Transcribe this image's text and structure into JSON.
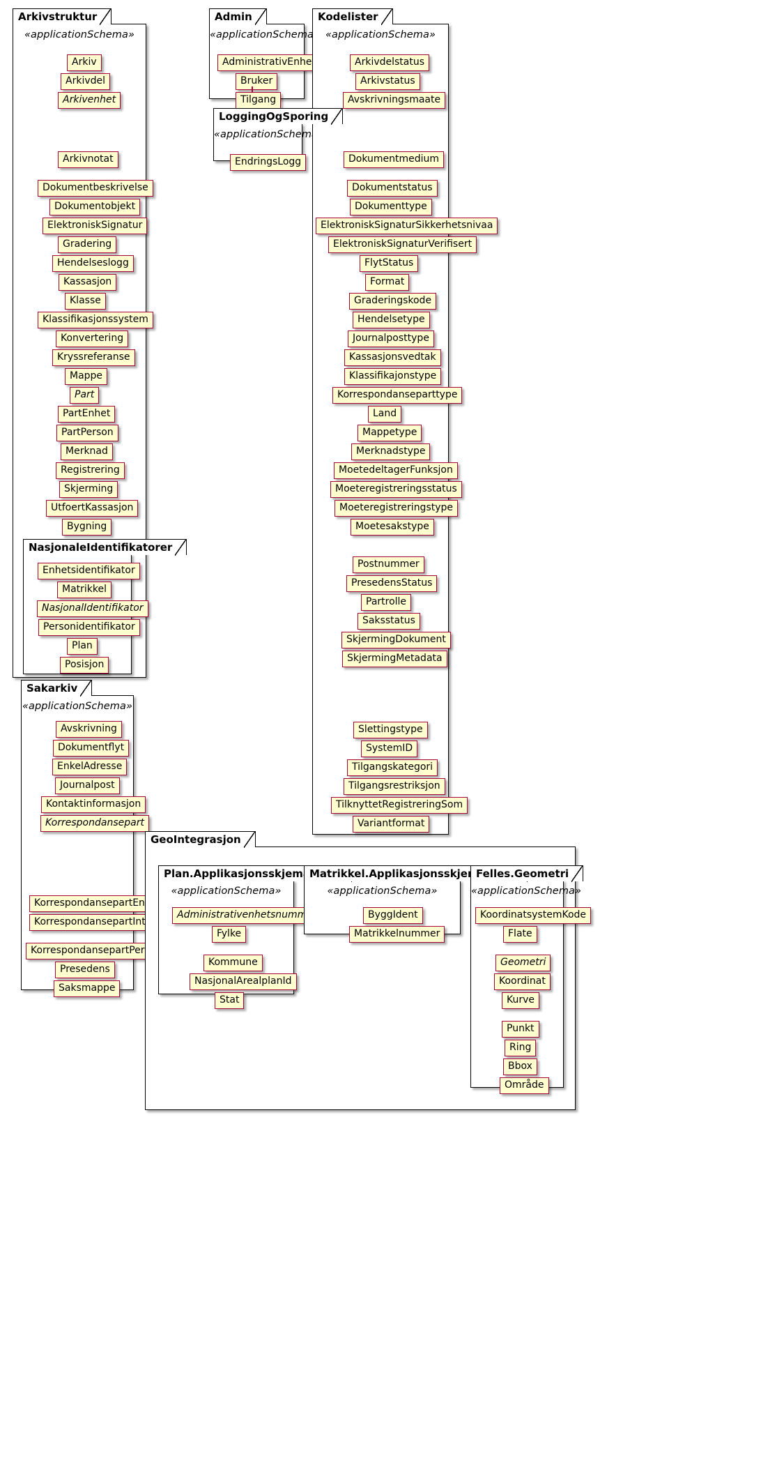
{
  "diagram": {
    "type": "uml-package-diagram",
    "stereotype_label": "«applicationSchema»",
    "colors": {
      "class_fill": "#FEFECE",
      "class_border": "#A80036",
      "package_border": "#000000",
      "background": "#FFFFFF"
    }
  },
  "packages": {
    "arkivstruktur": {
      "name": "Arkivstruktur",
      "stereotype": "«applicationSchema»",
      "classes": [
        {
          "name": "Arkiv",
          "abstract": false
        },
        {
          "name": "Arkivdel",
          "abstract": false
        },
        {
          "name": "Arkivenhet",
          "abstract": true
        },
        {
          "name": "Arkivnotat",
          "abstract": false
        },
        {
          "name": "Dokumentbeskrivelse",
          "abstract": false
        },
        {
          "name": "Dokumentobjekt",
          "abstract": false
        },
        {
          "name": "ElektroniskSignatur",
          "abstract": false
        },
        {
          "name": "Gradering",
          "abstract": false
        },
        {
          "name": "Hendelseslogg",
          "abstract": false
        },
        {
          "name": "Kassasjon",
          "abstract": false
        },
        {
          "name": "Klasse",
          "abstract": false
        },
        {
          "name": "Klassifikasjonssystem",
          "abstract": false
        },
        {
          "name": "Konvertering",
          "abstract": false
        },
        {
          "name": "Kryssreferanse",
          "abstract": false
        },
        {
          "name": "Mappe",
          "abstract": false
        },
        {
          "name": "Part",
          "abstract": true
        },
        {
          "name": "PartEnhet",
          "abstract": false
        },
        {
          "name": "PartPerson",
          "abstract": false
        },
        {
          "name": "Merknad",
          "abstract": false
        },
        {
          "name": "Registrering",
          "abstract": false
        },
        {
          "name": "Skjerming",
          "abstract": false
        },
        {
          "name": "UtfoertKassasjon",
          "abstract": false
        },
        {
          "name": "Bygning",
          "abstract": false
        }
      ],
      "nested": {
        "nasjonaleidentifikatorer": {
          "name": "NasjonaleIdentifikatorer",
          "classes": [
            {
              "name": "Enhetsidentifikator",
              "abstract": false
            },
            {
              "name": "Matrikkel",
              "abstract": false
            },
            {
              "name": "NasjonalIdentifikator",
              "abstract": true
            },
            {
              "name": "Personidentifikator",
              "abstract": false
            },
            {
              "name": "Plan",
              "abstract": false
            },
            {
              "name": "Posisjon",
              "abstract": false
            }
          ]
        }
      }
    },
    "sakarkiv": {
      "name": "Sakarkiv",
      "stereotype": "«applicationSchema»",
      "classes": [
        {
          "name": "Avskrivning",
          "abstract": false
        },
        {
          "name": "Dokumentflyt",
          "abstract": false
        },
        {
          "name": "EnkelAdresse",
          "abstract": false
        },
        {
          "name": "Journalpost",
          "abstract": false
        },
        {
          "name": "Kontaktinformasjon",
          "abstract": false
        },
        {
          "name": "Korrespondansepart",
          "abstract": true
        },
        {
          "name": "KorrespondansepartEnhet",
          "abstract": false
        },
        {
          "name": "KorrespondansepartIntern",
          "abstract": false
        },
        {
          "name": "KorrespondansepartPerson",
          "abstract": false
        },
        {
          "name": "Presedens",
          "abstract": false
        },
        {
          "name": "Saksmappe",
          "abstract": false
        }
      ]
    },
    "admin": {
      "name": "Admin",
      "stereotype": "«applicationSchema»",
      "classes": [
        {
          "name": "AdministrativEnhet",
          "abstract": false
        },
        {
          "name": "Bruker",
          "abstract": false
        },
        {
          "name": "Tilgang",
          "abstract": false
        }
      ]
    },
    "loggingogsporing": {
      "name": "LoggingOgSporing",
      "stereotype": "«applicationSchema»",
      "classes": [
        {
          "name": "EndringsLogg",
          "abstract": false
        }
      ]
    },
    "kodelister": {
      "name": "Kodelister",
      "stereotype": "«applicationSchema»",
      "classes": [
        {
          "name": "Arkivdelstatus",
          "abstract": false
        },
        {
          "name": "Arkivstatus",
          "abstract": false
        },
        {
          "name": "Avskrivningsmaate",
          "abstract": false
        },
        {
          "name": "Dokumentmedium",
          "abstract": false
        },
        {
          "name": "Dokumentstatus",
          "abstract": false
        },
        {
          "name": "Dokumenttype",
          "abstract": false
        },
        {
          "name": "ElektroniskSignaturSikkerhetsnivaa",
          "abstract": false
        },
        {
          "name": "ElektroniskSignaturVerifisert",
          "abstract": false
        },
        {
          "name": "FlytStatus",
          "abstract": false
        },
        {
          "name": "Format",
          "abstract": false
        },
        {
          "name": "Graderingskode",
          "abstract": false
        },
        {
          "name": "Hendelsetype",
          "abstract": false
        },
        {
          "name": "Journalposttype",
          "abstract": false
        },
        {
          "name": "Kassasjonsvedtak",
          "abstract": false
        },
        {
          "name": "Klassifikajonstype",
          "abstract": false
        },
        {
          "name": "Korrespondanseparttype",
          "abstract": false
        },
        {
          "name": "Land",
          "abstract": false
        },
        {
          "name": "Mappetype",
          "abstract": false
        },
        {
          "name": "Merknadstype",
          "abstract": false
        },
        {
          "name": "MoetedeltagerFunksjon",
          "abstract": false
        },
        {
          "name": "Moeteregistreringsstatus",
          "abstract": false
        },
        {
          "name": "Moeteregistreringstype",
          "abstract": false
        },
        {
          "name": "Moetesakstype",
          "abstract": false
        },
        {
          "name": "Postnummer",
          "abstract": false
        },
        {
          "name": "PresedensStatus",
          "abstract": false
        },
        {
          "name": "Partrolle",
          "abstract": false
        },
        {
          "name": "Saksstatus",
          "abstract": false
        },
        {
          "name": "SkjermingDokument",
          "abstract": false
        },
        {
          "name": "SkjermingMetadata",
          "abstract": false
        },
        {
          "name": "Slettingstype",
          "abstract": false
        },
        {
          "name": "SystemID",
          "abstract": false
        },
        {
          "name": "Tilgangskategori",
          "abstract": false
        },
        {
          "name": "Tilgangsrestriksjon",
          "abstract": false
        },
        {
          "name": "TilknyttetRegistreringSom",
          "abstract": false
        },
        {
          "name": "Variantformat",
          "abstract": false
        }
      ]
    },
    "geointegrasjon": {
      "name": "GeoIntegrasjon",
      "nested": {
        "plan_felles": {
          "name": "Plan.Applikasjonsskjema.Felles",
          "stereotype": "«applicationSchema»",
          "classes": [
            {
              "name": "Administrativenhetsnummer",
              "abstract": true
            },
            {
              "name": "Fylke",
              "abstract": false
            },
            {
              "name": "Kommune",
              "abstract": false
            },
            {
              "name": "NasjonalArealplanId",
              "abstract": false
            },
            {
              "name": "Stat",
              "abstract": false
            }
          ]
        },
        "matrikkel_felles": {
          "name": "Matrikkel.Applikasjonsskjema.Felles",
          "stereotype": "«applicationSchema»",
          "classes": [
            {
              "name": "ByggIdent",
              "abstract": false
            },
            {
              "name": "Matrikkelnummer",
              "abstract": false
            }
          ]
        },
        "felles_geometri": {
          "name": "Felles.Geometri",
          "stereotype": "«applicationSchema»",
          "classes": [
            {
              "name": "KoordinatsystemKode",
              "abstract": false
            },
            {
              "name": "Flate",
              "abstract": false
            },
            {
              "name": "Geometri",
              "abstract": true
            },
            {
              "name": "Koordinat",
              "abstract": false
            },
            {
              "name": "Kurve",
              "abstract": false
            },
            {
              "name": "Punkt",
              "abstract": false
            },
            {
              "name": "Ring",
              "abstract": false
            },
            {
              "name": "Bbox",
              "abstract": false
            },
            {
              "name": "Område",
              "abstract": false
            }
          ]
        }
      }
    }
  }
}
